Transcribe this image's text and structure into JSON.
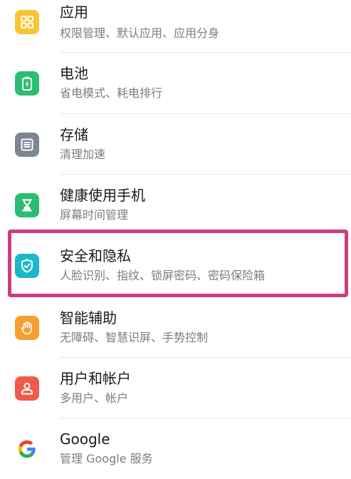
{
  "settings_list": [
    {
      "id": "apps",
      "title": "应用",
      "subtitle": "权限管理、默认应用、应用分身",
      "icon": "apps-grid-icon",
      "icon_color": "#f7c531"
    },
    {
      "id": "battery",
      "title": "电池",
      "subtitle": "省电模式、耗电排行",
      "icon": "battery-icon",
      "icon_color": "#2bbd72"
    },
    {
      "id": "storage",
      "title": "存储",
      "subtitle": "清理加速",
      "icon": "storage-icon",
      "icon_color": "#7d8590"
    },
    {
      "id": "digital-balance",
      "title": "健康使用手机",
      "subtitle": "屏幕时间管理",
      "icon": "hourglass-icon",
      "icon_color": "#2bbd72"
    },
    {
      "id": "security-privacy",
      "title": "安全和隐私",
      "subtitle": "人脸识别、指纹、锁屏密码、密码保险箱",
      "icon": "shield-check-icon",
      "icon_color": "#1bb8c8",
      "highlighted": true
    },
    {
      "id": "accessibility",
      "title": "智能辅助",
      "subtitle": "无障碍、智慧识屏、手势控制",
      "icon": "hand-icon",
      "icon_color": "#f59f33"
    },
    {
      "id": "users-accounts",
      "title": "用户和帐户",
      "subtitle": "多用户、帐户",
      "icon": "user-icon",
      "icon_color": "#ef5a4c"
    },
    {
      "id": "google",
      "title": "Google",
      "subtitle": "管理 Google 服务",
      "icon": "google-icon",
      "icon_color": "#ffffff"
    }
  ],
  "highlight_color": "#cc3d7f"
}
